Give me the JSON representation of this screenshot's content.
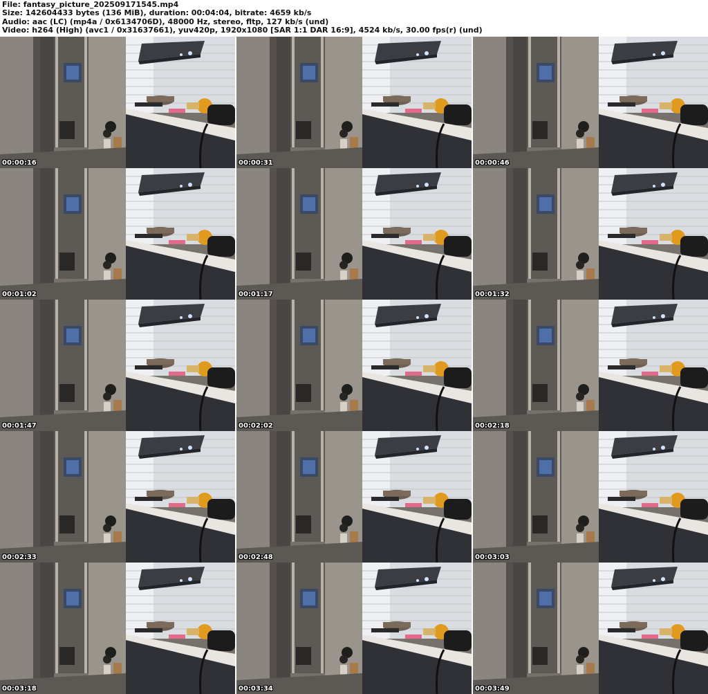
{
  "header": {
    "file_line": "File: fantasy_picture_202509171545.mp4",
    "size_line": "Size: 142604433 bytes (136 MiB), duration: 00:04:04, bitrate: 4659 kb/s",
    "audio_line": "Audio: aac (LC) (mp4a / 0x6134706D), 48000 Hz, stereo, fltp, 127 kb/s (und)",
    "video_line": "Video: h264 (High) (avc1 / 0x31637661), yuv420p, 1920x1080 [SAR 1:1 DAR 16:9], 4524 kb/s, 30.00 fps(r) (und)"
  },
  "thumbnails": [
    {
      "timestamp": "00:00:16"
    },
    {
      "timestamp": "00:00:31"
    },
    {
      "timestamp": "00:00:46"
    },
    {
      "timestamp": "00:01:02"
    },
    {
      "timestamp": "00:01:17"
    },
    {
      "timestamp": "00:01:32"
    },
    {
      "timestamp": "00:01:47"
    },
    {
      "timestamp": "00:02:02"
    },
    {
      "timestamp": "00:02:18"
    },
    {
      "timestamp": "00:02:33"
    },
    {
      "timestamp": "00:02:48"
    },
    {
      "timestamp": "00:03:03"
    },
    {
      "timestamp": "00:03:18"
    },
    {
      "timestamp": "00:03:34"
    },
    {
      "timestamp": "00:03:49"
    }
  ]
}
